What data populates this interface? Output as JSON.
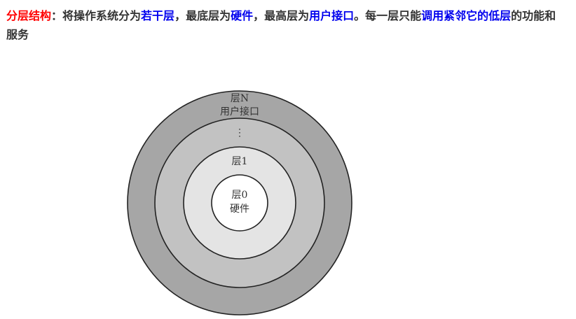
{
  "text": {
    "term": "分层结构",
    "colon": "：",
    "p1": "将操作系统分为",
    "e1": "若干层",
    "p2": "，最底层为",
    "e2": "硬件",
    "p3": "，最高层为",
    "e3": "用户接口",
    "p4": "。每一层只能",
    "e4": "调用紧邻它的低层",
    "p5": "的功能和服务"
  },
  "diagram": {
    "ring_outer": {
      "title": "层N",
      "subtitle": "用户接口"
    },
    "ellipsis": "⋮",
    "ring_middle": {
      "title": "层1"
    },
    "core": {
      "title": "层0",
      "subtitle": "硬件"
    }
  },
  "colors": {
    "emphasis_red": "#ff0000",
    "emphasis_blue": "#0000ee",
    "ring_outer_fill": "#a6a6a6",
    "ring_second_fill": "#c2c2c2",
    "ring_third_fill": "#e4e4e4",
    "core_fill": "#ffffff"
  }
}
